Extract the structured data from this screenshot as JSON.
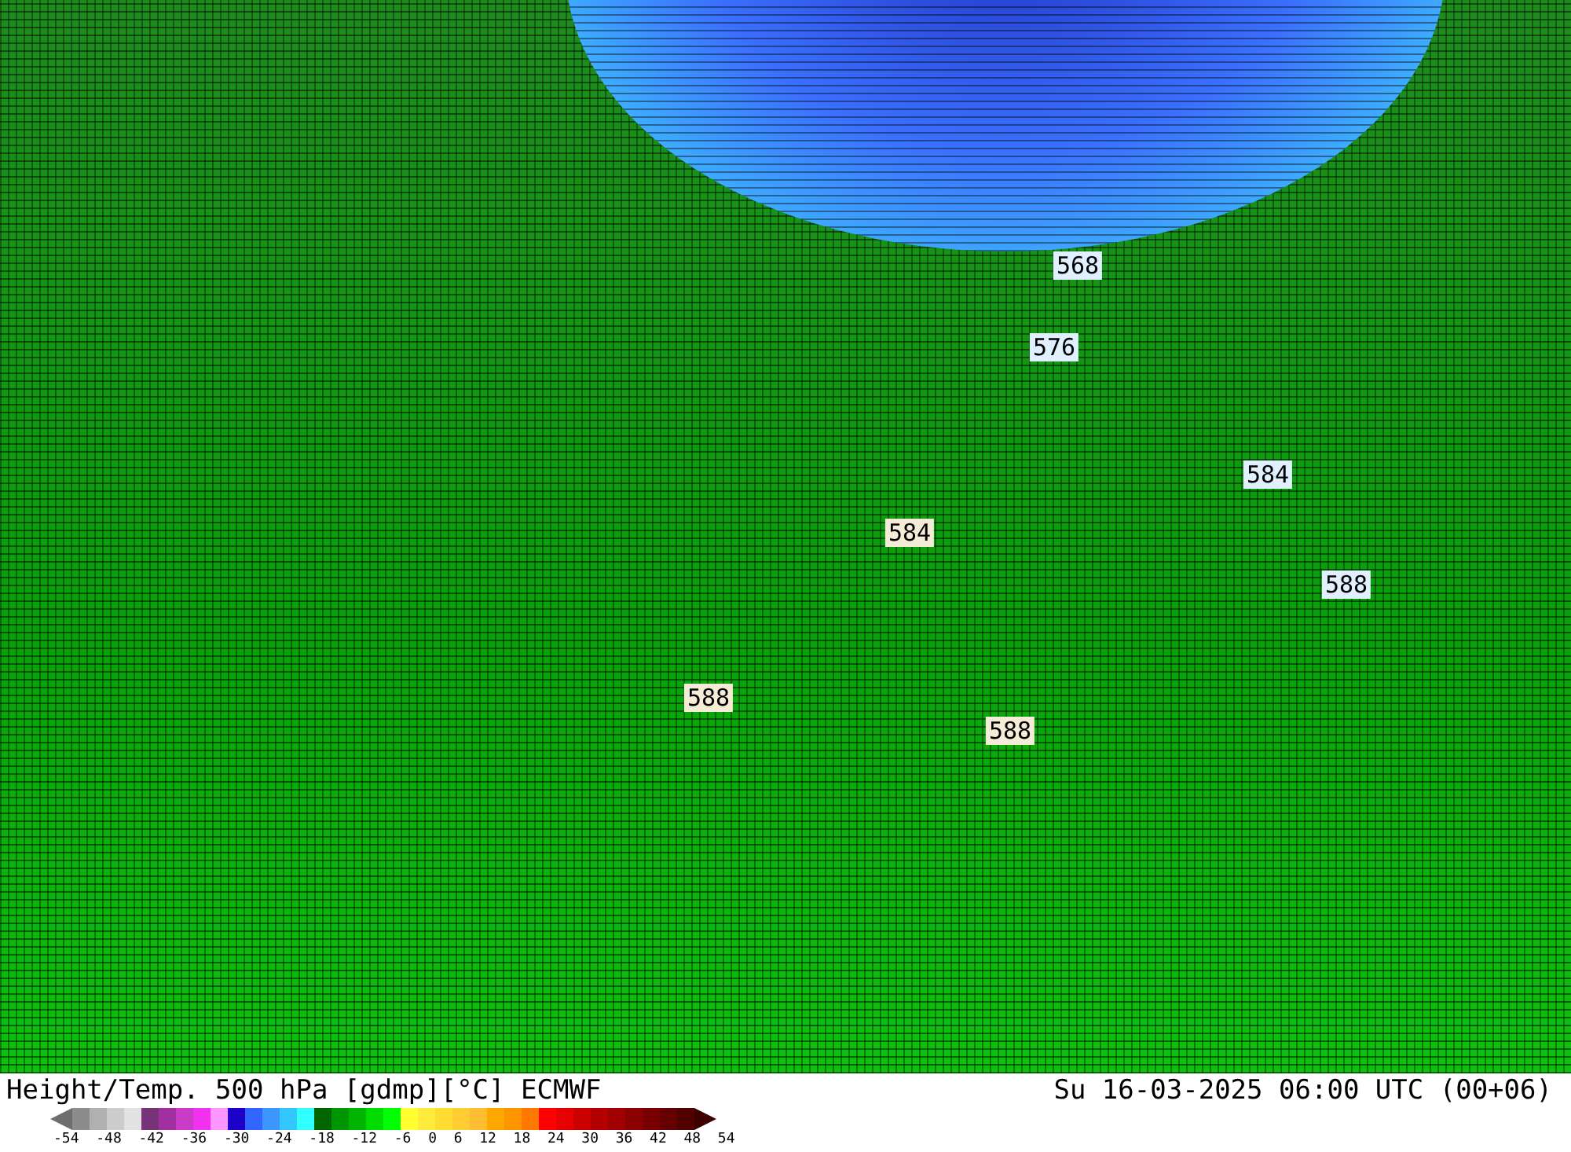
{
  "map": {
    "contour_labels": [
      {
        "text": "568",
        "color": "#e0f0ff"
      },
      {
        "text": "576",
        "color": "#e0f0ff"
      },
      {
        "text": "584",
        "color": "#e0f0ff"
      },
      {
        "text": "584",
        "color": "#f5ecd8"
      },
      {
        "text": "588",
        "color": "#e0f0ff"
      },
      {
        "text": "588",
        "color": "#f5ecd8"
      },
      {
        "text": "588",
        "color": "#f5ecd8"
      }
    ]
  },
  "footer": {
    "title": "Height/Temp. 500 hPa [gdmp][°C] ECMWF",
    "valid_time": "Su 16-03-2025 06:00 UTC (00+06)",
    "colorbar": {
      "ticks": [
        "-54",
        "-48",
        "-42",
        "-36",
        "-30",
        "-24",
        "-18",
        "-12",
        "-6",
        "0",
        "6",
        "12",
        "18",
        "24",
        "30",
        "36",
        "42",
        "48",
        "54"
      ]
    }
  }
}
